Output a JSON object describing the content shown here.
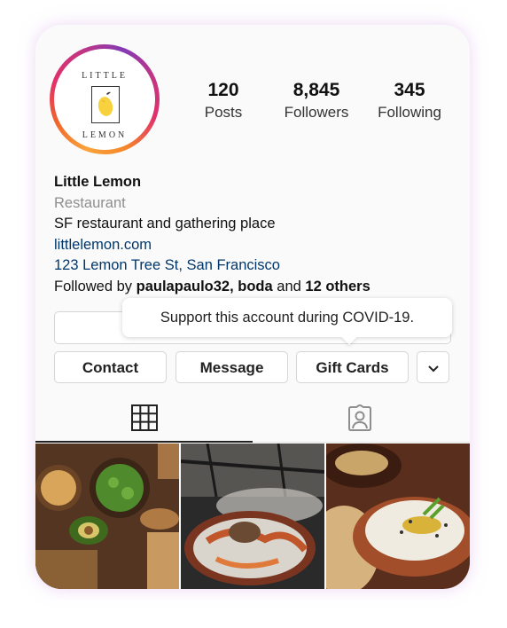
{
  "profile": {
    "logo_top": "LITTLE",
    "logo_bottom": "LEMON",
    "stats": [
      {
        "value": "120",
        "label": "Posts"
      },
      {
        "value": "8,845",
        "label": "Followers"
      },
      {
        "value": "345",
        "label": "Following"
      }
    ],
    "name": "Little Lemon",
    "category": "Restaurant",
    "bio": "SF restaurant and gathering place",
    "website": "littlelemon.com",
    "address": "123 Lemon Tree St, San Francisco",
    "followed_by_prefix": "Followed by",
    "followed_by_users": "paulapaulo32, boda",
    "followed_by_and": "and",
    "followed_by_others": "12 others"
  },
  "tooltip": {
    "text": "Support this account during COVID-19."
  },
  "actions": {
    "contact": "Contact",
    "message": "Message",
    "gift_cards": "Gift Cards"
  },
  "tabs": {
    "icons": [
      "grid-icon",
      "tagged-icon"
    ]
  },
  "photos": {
    "items": [
      "chickpeas-and-avocado-photo",
      "grilled-seafood-photo",
      "hummus-dip-photo"
    ]
  },
  "colors": {
    "link": "#00376b",
    "muted": "#8e8e8e",
    "ring_start": "#f9a43a",
    "ring_end": "#833ab4",
    "lemon": "#f7d23e"
  }
}
